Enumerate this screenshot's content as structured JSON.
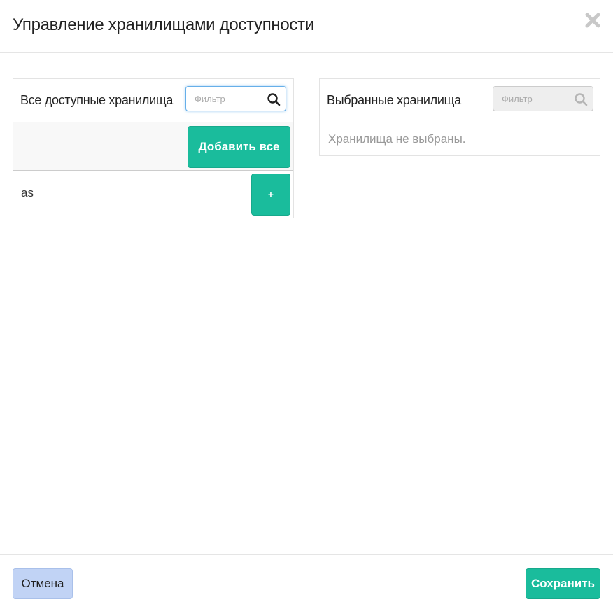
{
  "modal": {
    "title": "Управление хранилищами доступности",
    "close_icon": "close-icon"
  },
  "available": {
    "heading": "Все доступные хранилища",
    "filter_placeholder": "Фильтр",
    "filter_icon": "search-icon",
    "add_all_label": "Добавить все",
    "items": [
      {
        "name": "as",
        "add_label": "+"
      }
    ]
  },
  "selected": {
    "heading": "Выбранные хранилища",
    "filter_placeholder": "Фильтр",
    "filter_icon": "search-icon",
    "empty_text": "Хранилища не выбраны."
  },
  "footer": {
    "cancel_label": "Отмена",
    "save_label": "Сохранить"
  },
  "colors": {
    "primary_green": "#1abc9c",
    "cancel_blue": "#c1d3f5",
    "focus_blue": "#66afe9"
  }
}
